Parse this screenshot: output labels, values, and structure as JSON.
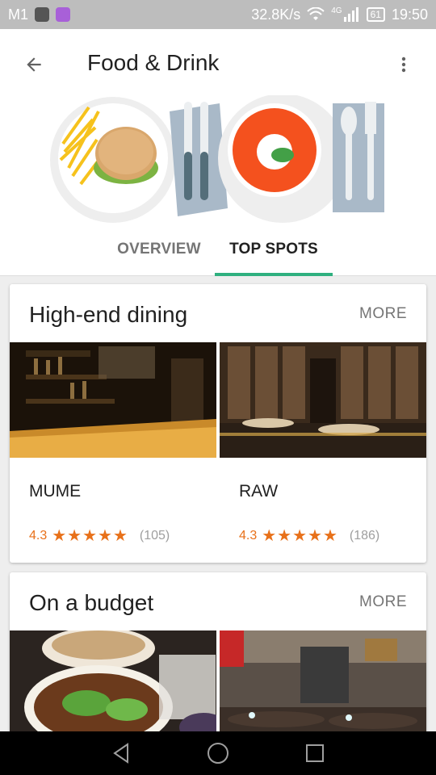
{
  "status_bar": {
    "carrier": "M1",
    "network_speed": "32.8K/s",
    "network_type": "4G",
    "battery": "61",
    "time": "19:50"
  },
  "app_bar": {
    "title": "Food & Drink"
  },
  "tabs": [
    {
      "label": "OVERVIEW",
      "selected": false
    },
    {
      "label": "TOP SPOTS",
      "selected": true
    }
  ],
  "colors": {
    "accent": "#2fb07f",
    "rating": "#e8711a"
  },
  "sections": [
    {
      "title": "High-end dining",
      "more_label": "MORE",
      "places": [
        {
          "name": "MUME",
          "rating": "4.3",
          "stars": "★★★★★",
          "reviews": "(105)"
        },
        {
          "name": "RAW",
          "rating": "4.3",
          "stars": "★★★★★",
          "reviews": "(186)"
        }
      ]
    },
    {
      "title": "On a budget",
      "more_label": "MORE"
    }
  ],
  "icons": {
    "back": "arrow-back-icon",
    "menu": "more-vert-icon",
    "nav": [
      "nav-back-icon",
      "nav-home-icon",
      "nav-recents-icon"
    ]
  }
}
